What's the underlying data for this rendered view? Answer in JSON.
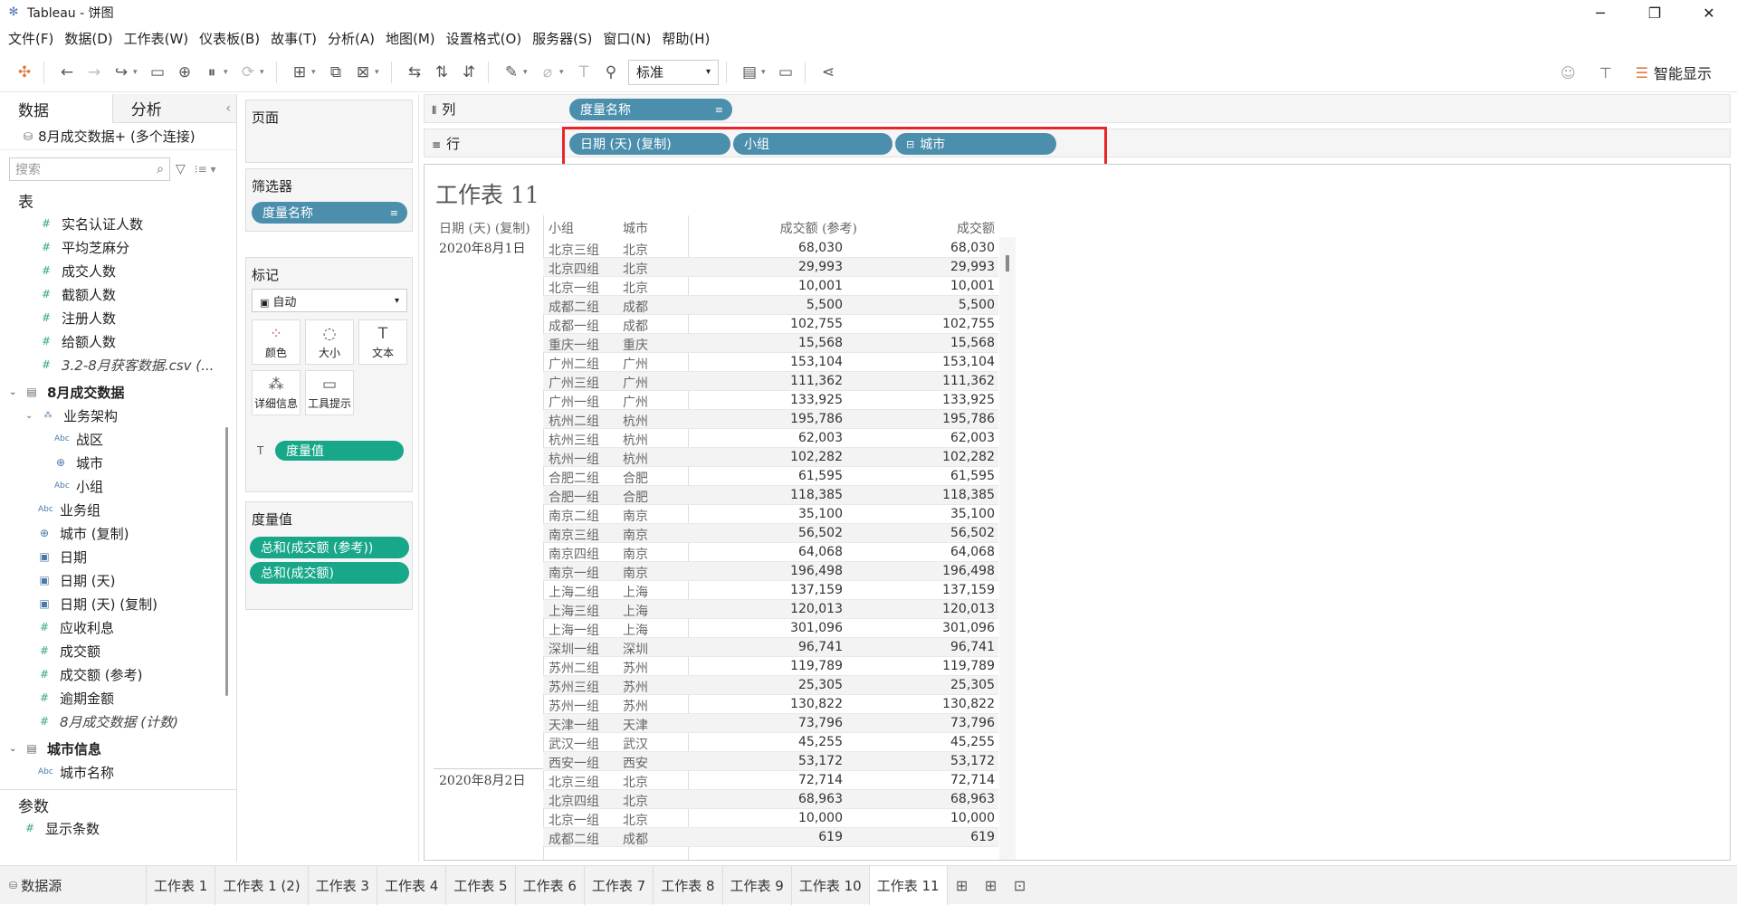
{
  "window": {
    "title": "Tableau - 饼图",
    "minimize": "─",
    "restore": "❐",
    "close": "✕"
  },
  "menu": [
    "文件(F)",
    "数据(D)",
    "工作表(W)",
    "仪表板(B)",
    "故事(T)",
    "分析(A)",
    "地图(M)",
    "设置格式(O)",
    "服务器(S)",
    "窗口(N)",
    "帮助(H)"
  ],
  "toolbar": {
    "fit_select": "标准",
    "smart_show": "智能显示"
  },
  "left_pane": {
    "tab_data": "数据",
    "tab_analysis": "分析",
    "datasource": "8月成交数据+ (多个连接)",
    "search_placeholder": "搜索",
    "tables_header": "表",
    "fields_a": [
      "实名认证人数",
      "平均芝麻分",
      "成交人数",
      "截额人数",
      "注册人数",
      "给额人数"
    ],
    "csv_item": "3.2-8月获客数据.csv (...",
    "group1": "8月成交数据",
    "hierarchy": "业务架构",
    "hier_children": [
      "战区",
      "城市",
      "小组"
    ],
    "fields_b": [
      "业务组",
      "城市 (复制)",
      "日期",
      "日期 (天)",
      "日期 (天) (复制)",
      "应收利息",
      "成交额",
      "成交额 (参考)",
      "逾期金额"
    ],
    "count_item": "8月成交数据 (计数)",
    "group2": "城市信息",
    "city_name": "城市名称",
    "params_header": "参数",
    "param_item": "显示条数"
  },
  "middle_pane": {
    "pages": "页面",
    "filters": "筛选器",
    "filter_pill": "度量名称",
    "marks": "标记",
    "marks_type": "自动",
    "mark_buttons": [
      "颜色",
      "大小",
      "文本",
      "详细信息",
      "工具提示"
    ],
    "marks_pill": "度量值",
    "measure_values": "度量值",
    "mv_pills": [
      "总和(成交额 (参考))",
      "总和(成交额)"
    ]
  },
  "shelves": {
    "columns_label": "列",
    "columns_pill": "度量名称",
    "rows_label": "行",
    "rows_pills": [
      "日期 (天) (复制)",
      "小组",
      "城市"
    ]
  },
  "view": {
    "title": "工作表 11",
    "headers": [
      "日期 (天) (复制)",
      "小组",
      "城市",
      "成交额 (参考)",
      "成交额"
    ],
    "dates": [
      "2020年8月1日",
      "2020年8月2日"
    ],
    "rows": [
      [
        "北京三组",
        "北京",
        "68,030",
        "68,030"
      ],
      [
        "北京四组",
        "北京",
        "29,993",
        "29,993"
      ],
      [
        "北京一组",
        "北京",
        "10,001",
        "10,001"
      ],
      [
        "成都二组",
        "成都",
        "5,500",
        "5,500"
      ],
      [
        "成都一组",
        "成都",
        "102,755",
        "102,755"
      ],
      [
        "重庆一组",
        "重庆",
        "15,568",
        "15,568"
      ],
      [
        "广州二组",
        "广州",
        "153,104",
        "153,104"
      ],
      [
        "广州三组",
        "广州",
        "111,362",
        "111,362"
      ],
      [
        "广州一组",
        "广州",
        "133,925",
        "133,925"
      ],
      [
        "杭州二组",
        "杭州",
        "195,786",
        "195,786"
      ],
      [
        "杭州三组",
        "杭州",
        "62,003",
        "62,003"
      ],
      [
        "杭州一组",
        "杭州",
        "102,282",
        "102,282"
      ],
      [
        "合肥二组",
        "合肥",
        "61,595",
        "61,595"
      ],
      [
        "合肥一组",
        "合肥",
        "118,385",
        "118,385"
      ],
      [
        "南京二组",
        "南京",
        "35,100",
        "35,100"
      ],
      [
        "南京三组",
        "南京",
        "56,502",
        "56,502"
      ],
      [
        "南京四组",
        "南京",
        "64,068",
        "64,068"
      ],
      [
        "南京一组",
        "南京",
        "196,498",
        "196,498"
      ],
      [
        "上海二组",
        "上海",
        "137,159",
        "137,159"
      ],
      [
        "上海三组",
        "上海",
        "120,013",
        "120,013"
      ],
      [
        "上海一组",
        "上海",
        "301,096",
        "301,096"
      ],
      [
        "深圳一组",
        "深圳",
        "96,741",
        "96,741"
      ],
      [
        "苏州二组",
        "苏州",
        "119,789",
        "119,789"
      ],
      [
        "苏州三组",
        "苏州",
        "25,305",
        "25,305"
      ],
      [
        "苏州一组",
        "苏州",
        "130,822",
        "130,822"
      ],
      [
        "天津一组",
        "天津",
        "73,796",
        "73,796"
      ],
      [
        "武汉一组",
        "武汉",
        "45,255",
        "45,255"
      ],
      [
        "西安一组",
        "西安",
        "53,172",
        "53,172"
      ],
      [
        "北京三组",
        "北京",
        "72,714",
        "72,714"
      ],
      [
        "北京四组",
        "北京",
        "68,963",
        "68,963"
      ],
      [
        "北京一组",
        "北京",
        "10,000",
        "10,000"
      ],
      [
        "成都二组",
        "成都",
        "619",
        "619"
      ]
    ]
  },
  "bottom_tabs": {
    "datasource": "数据源",
    "sheets": [
      "工作表 1",
      "工作表 1 (2)",
      "工作表 3",
      "工作表 4",
      "工作表 5",
      "工作表 6",
      "工作表 7",
      "工作表 8",
      "工作表 9",
      "工作表 10",
      "工作表 11"
    ],
    "active": "工作表 11"
  },
  "colors": {
    "blue_pill": "#4b8fad",
    "green_pill": "#18a889",
    "highlight": "#e8262a"
  }
}
